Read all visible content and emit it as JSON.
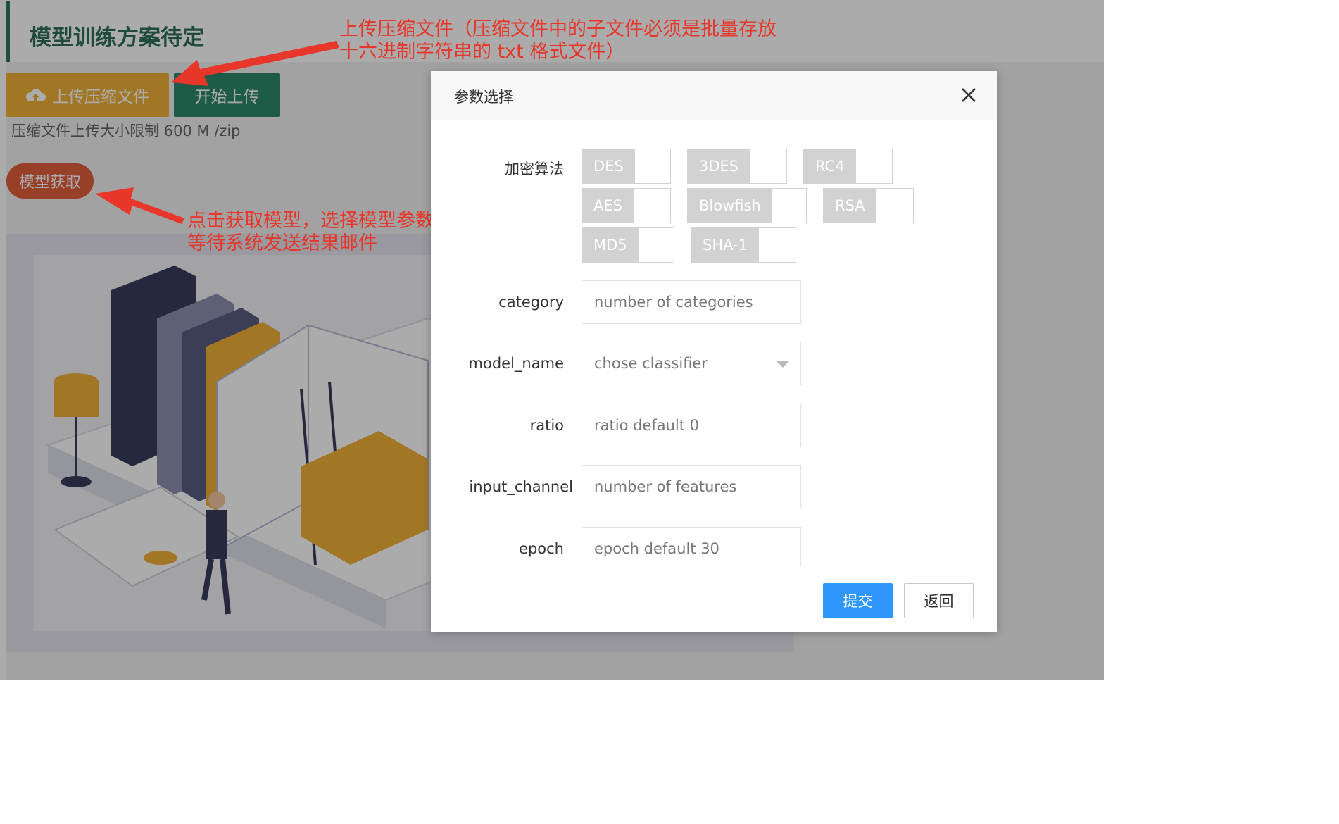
{
  "page": {
    "title": "模型训练方案待定",
    "upload_zip_label": "上传压缩文件",
    "start_upload_label": "开始上传",
    "upload_hint": "压缩文件上传大小限制 600 M /zip",
    "get_model_label": "模型获取"
  },
  "annotations": {
    "upload_note_line1": "上传压缩文件（压缩文件中的子文件必须是批量存放",
    "upload_note_line2": "十六进制字符串的 txt 格式文件）",
    "model_note_line1": "点击获取模型，选择模型参数之后提交，",
    "model_note_line2": "等待系统发送结果邮件",
    "color": "#e8362a"
  },
  "dialog": {
    "title": "参数选择",
    "encryption_label": "加密算法",
    "algorithms": [
      "DES",
      "3DES",
      "RC4",
      "AES",
      "Blowfish",
      "RSA",
      "MD5",
      "SHA-1"
    ],
    "fields": {
      "category": {
        "label": "category",
        "placeholder": "number of categories"
      },
      "model_name": {
        "label": "model_name",
        "placeholder": "chose classifier"
      },
      "ratio": {
        "label": "ratio",
        "placeholder": "ratio default 0"
      },
      "input_channel": {
        "label": "input_channel",
        "placeholder": "number of features"
      },
      "epoch": {
        "label": "epoch",
        "placeholder": "epoch default 30"
      }
    },
    "submit_label": "提交",
    "back_label": "返回"
  },
  "colors": {
    "upload_button": "#f0b23a",
    "start_button": "#2f8a6a",
    "get_model_button": "#e35f3c",
    "submit_button": "#2f98ff",
    "title_text": "#2f6f5c"
  },
  "icons": {
    "upload": "cloud-upload-icon",
    "close": "close-icon",
    "select_caret": "caret-down-icon"
  }
}
